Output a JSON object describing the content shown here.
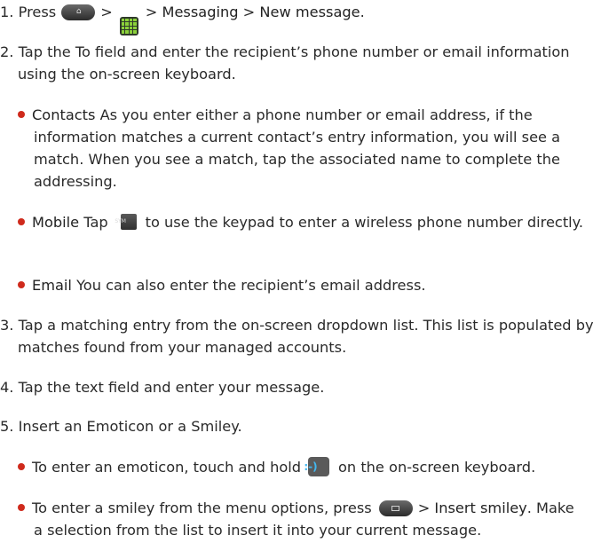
{
  "steps": {
    "s1": {
      "prefix": "1. Press",
      "gt1": ">",
      "after_grid": "> ",
      "messaging": "Messaging",
      "gt3": " > ",
      "new_message": "New message",
      "end": "."
    },
    "s2": "2. Tap the To field and enter the recipient’s phone number or email information using the on-screen keyboard.",
    "s2_bullets": {
      "contacts": {
        "label": "Contacts",
        "text": " As you enter either a phone number or email address, if the information matches a current contact’s entry information, you will see a match. When you see a match, tap the associated name to complete the addressing."
      },
      "mobile": {
        "label": "Mobile",
        "text_before": " Tap",
        "text_after": "to use the keypad to enter a wireless phone number directly."
      },
      "email": {
        "label": "Email",
        "text": " You can also enter the recipient’s email address."
      }
    },
    "s3": "3. Tap a matching entry from the on-screen dropdown list. This list is populated by matches found from your managed accounts.",
    "s4": "4. Tap the text field and enter your message.",
    "s5": "5. Insert an Emoticon or a Smiley.",
    "s5_bullets": {
      "emoticon": {
        "before": "To enter an emoticon, touch and hold",
        "after": "on the on-screen keyboard."
      },
      "smiley": {
        "before": "To enter a smiley from the menu options, press",
        "gt": "> ",
        "label": "Insert smiley",
        "after": ". Make a selection from the list to insert it into your current message."
      }
    }
  },
  "keys": {
    "sym_label": "SYM",
    "emoticon_label": ":-)",
    "home_icon": "home-key-icon",
    "apps_icon": "apps-grid-icon",
    "menu_icon": "menu-key-icon"
  },
  "colors": {
    "bullet": "#cf2a1c",
    "apps_grid": "#8bd13a",
    "emoticon": "#43b8f0"
  }
}
